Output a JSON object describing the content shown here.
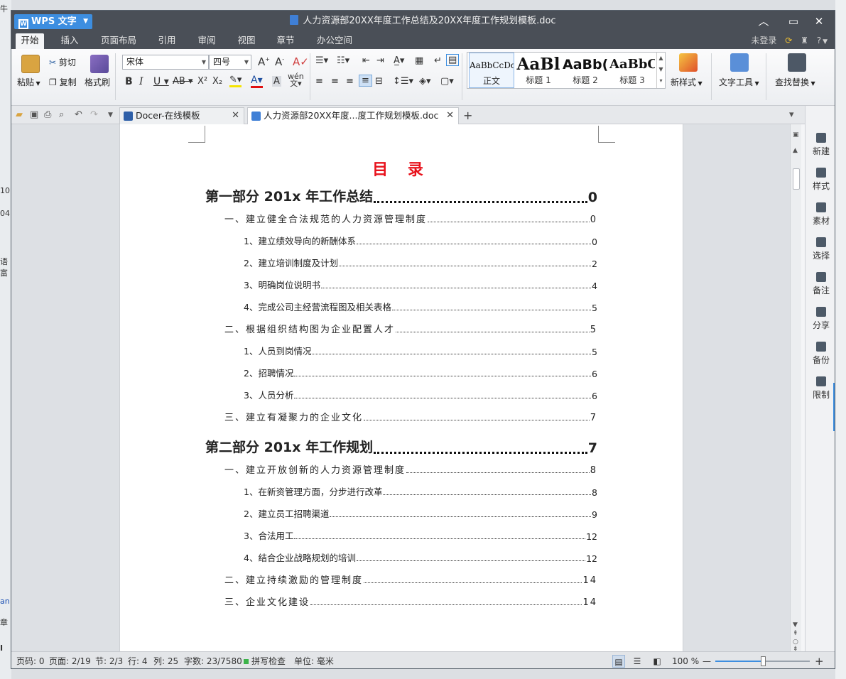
{
  "app": {
    "name": "WPS 文字",
    "window_title": "人力资源部20XX年度工作总结及20XX年度工作规划模板.doc"
  },
  "menu": {
    "tabs": [
      "开始",
      "插入",
      "页面布局",
      "引用",
      "审阅",
      "视图",
      "章节",
      "办公空间"
    ],
    "active_tab": "开始",
    "right": {
      "login": "未登录",
      "help": "?"
    }
  },
  "ribbon": {
    "paste": "粘贴",
    "cut": "剪切",
    "copy": "复制",
    "format_painter": "格式刷",
    "font_name": "宋体",
    "font_size": "四号",
    "styles": [
      {
        "preview": "AaBbCcDd",
        "label": "正文"
      },
      {
        "preview": "AaBl",
        "label": "标题 1"
      },
      {
        "preview": "AaBb(",
        "label": "标题 2"
      },
      {
        "preview": "AaBbC",
        "label": "标题 3"
      }
    ],
    "new_style": "新样式",
    "text_tools": "文字工具",
    "find_replace": "查找替换"
  },
  "tabs": [
    {
      "title": "Docer-在线模板",
      "active": false
    },
    {
      "title": "人力资源部20XX年度...度工作规划模板.doc",
      "active": true
    }
  ],
  "document": {
    "heading": "目 录",
    "toc": [
      {
        "level": 1,
        "text": "第一部分  201x 年工作总结",
        "page": "0"
      },
      {
        "level": 2,
        "text": "一、建立健全合法规范的人力资源管理制度",
        "page": "0"
      },
      {
        "level": 3,
        "text": "1、建立绩效导向的新酬体系",
        "page": "0"
      },
      {
        "level": 3,
        "text": "2、建立培训制度及计划",
        "page": "2"
      },
      {
        "level": 3,
        "text": "3、明确岗位说明书",
        "page": "4"
      },
      {
        "level": 3,
        "text": "4、完成公司主经营流程图及相关表格",
        "page": "5"
      },
      {
        "level": 2,
        "text": "二、根据组织结构图为企业配置人才",
        "page": "5"
      },
      {
        "level": 3,
        "text": "1、人员到岗情况",
        "page": "5"
      },
      {
        "level": 3,
        "text": "2、招聘情况",
        "page": "6"
      },
      {
        "level": 3,
        "text": "3、人员分析",
        "page": "6"
      },
      {
        "level": 2,
        "text": "三、建立有凝聚力的企业文化",
        "page": "7"
      },
      {
        "level": 1,
        "text": "第二部分  201x 年工作规划",
        "page": "7"
      },
      {
        "level": 2,
        "text": "一、建立开放创新的人力资源管理制度",
        "page": "8"
      },
      {
        "level": 3,
        "text": "1、在新资管理方面，分步进行改革",
        "page": "8"
      },
      {
        "level": 3,
        "text": "2、建立员工招聘渠道",
        "page": "9"
      },
      {
        "level": 3,
        "text": "3、合法用工",
        "page": "12"
      },
      {
        "level": 3,
        "text": "4、结合企业战略规划的培训",
        "page": "12"
      },
      {
        "level": 2,
        "text": "二、建立持续激励的管理制度",
        "page": "14"
      },
      {
        "level": 2,
        "text": "三、企业文化建设",
        "page": "14"
      }
    ]
  },
  "sidebar": [
    "新建",
    "样式",
    "素材",
    "选择",
    "备注",
    "分享",
    "备份",
    "限制"
  ],
  "status": {
    "page_code": "页码: 0",
    "page": "页面: 2/19",
    "section": "节: 2/3",
    "row": "行: 4",
    "col": "列: 25",
    "word_count": "字数: 23/7580",
    "spell_check": "拼写检查",
    "unit": "单位: 毫米",
    "zoom": "100 %",
    "zoom_level": 0.5
  },
  "desktop_fragments": [
    "牛",
    "10",
    "04",
    "语富",
    "an",
    "章",
    "I"
  ],
  "colors": {
    "accent": "#3d8ee0",
    "title_bar": "#4a4f57",
    "toc_heading": "#e8121c"
  }
}
